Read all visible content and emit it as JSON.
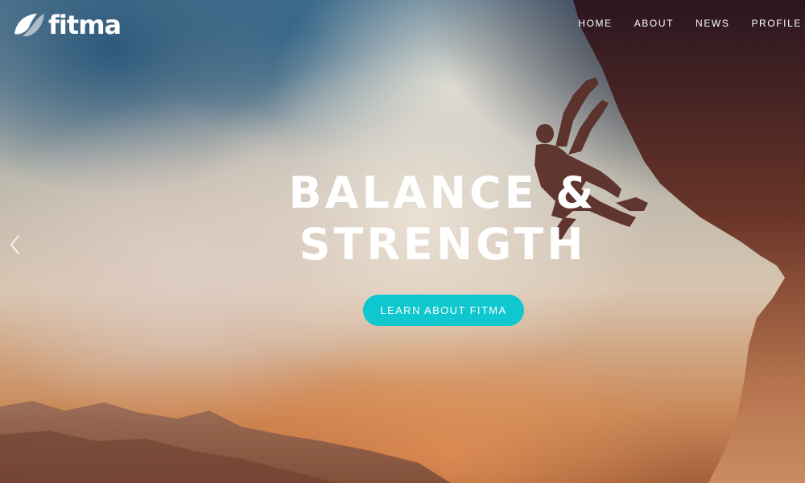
{
  "brand": {
    "name": "fitma",
    "logo_icon": "leaf-swoosh-icon"
  },
  "nav": {
    "items": [
      {
        "label": "HOME"
      },
      {
        "label": "ABOUT"
      },
      {
        "label": "NEWS"
      },
      {
        "label": "PROFILE"
      }
    ]
  },
  "hero": {
    "headline_line1": "BALANCE &",
    "headline_line2": "STRENGTH",
    "cta_label": "LEARN ABOUT FITMA",
    "prev_icon": "chevron-left-icon",
    "background_image": "rock-climber-silhouette-sunset"
  },
  "colors": {
    "accent": "#0fc7cf",
    "text": "#ffffff"
  }
}
